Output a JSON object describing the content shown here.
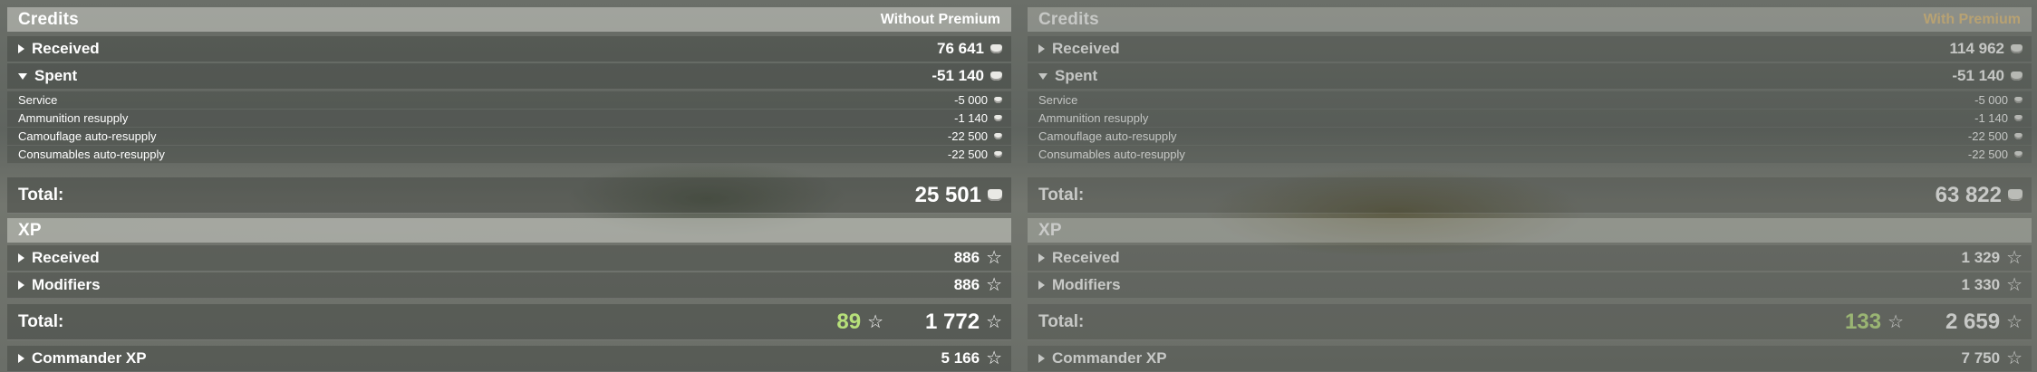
{
  "credits": {
    "title": "Credits",
    "left_caption": "Without Premium",
    "right_caption": "With Premium",
    "received_label": "Received",
    "spent_label": "Spent",
    "received_left": "76 641",
    "received_right": "114 962",
    "spent_left": "-51 140",
    "spent_right": "-51 140",
    "items": [
      {
        "label": "Service",
        "left": "-5 000",
        "right": "-5 000"
      },
      {
        "label": "Ammunition resupply",
        "left": "-1 140",
        "right": "-1 140"
      },
      {
        "label": "Camouflage auto-resupply",
        "left": "-22 500",
        "right": "-22 500"
      },
      {
        "label": "Consumables auto-resupply",
        "left": "-22 500",
        "right": "-22 500"
      }
    ],
    "total_label": "Total:",
    "total_left": "25 501",
    "total_right": "63 822"
  },
  "xp": {
    "title": "XP",
    "received_label": "Received",
    "modifiers_label": "Modifiers",
    "received_left": "886",
    "received_right": "1 329",
    "modifiers_left": "886",
    "modifiers_right": "1 330",
    "total_label": "Total:",
    "free_left": "89",
    "free_right": "133",
    "total_left": "1 772",
    "total_right": "2 659",
    "commander_label": "Commander XP",
    "commander_left": "5 166",
    "commander_right": "7 750"
  },
  "icons": {
    "star": "☆",
    "credit": "credit-icon"
  }
}
